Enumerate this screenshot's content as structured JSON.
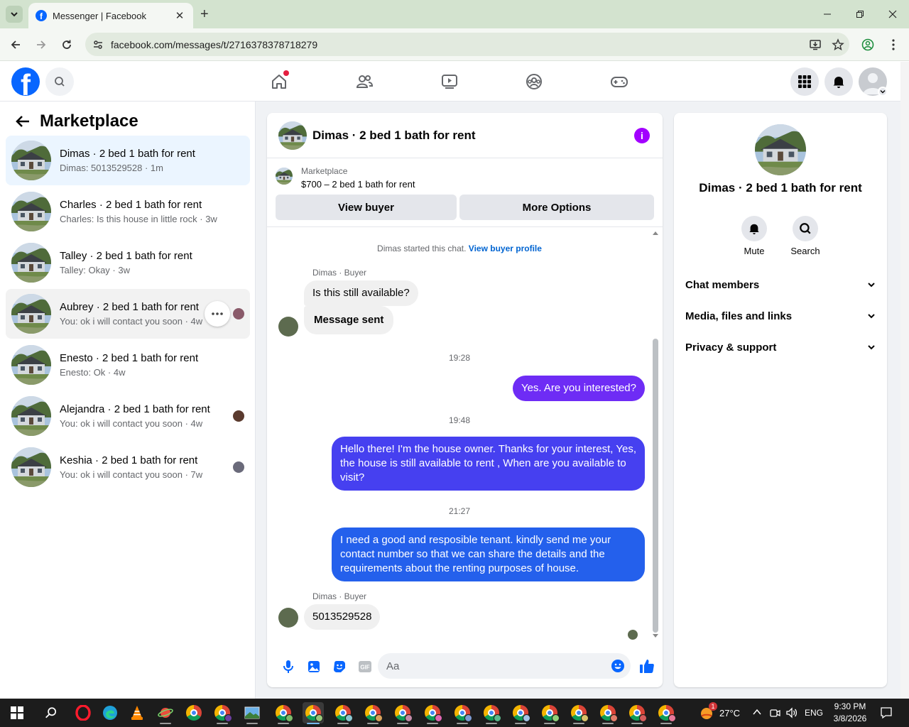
{
  "browser": {
    "tab_title": "Messenger | Facebook",
    "url": "facebook.com/messages/t/2716378378718279"
  },
  "left": {
    "title": "Marketplace",
    "chats": [
      {
        "name": "Dimas · 2 bed 1 bath for rent",
        "preview": "Dimas: 5013529528 · 1m",
        "state": "active"
      },
      {
        "name": "Charles · 2 bed 1 bath for rent",
        "preview": "Charles: Is this house in little rock · 3w",
        "state": ""
      },
      {
        "name": "Talley · 2 bed 1 bath for rent",
        "preview": "Talley: Okay · 3w",
        "state": ""
      },
      {
        "name": "Aubrey · 2 bed 1 bath for rent",
        "preview": "You: ok i will contact you soon · 4w",
        "state": "hover"
      },
      {
        "name": "Enesto · 2 bed 1 bath for rent",
        "preview": "Enesto: Ok · 4w",
        "state": ""
      },
      {
        "name": "Alejandra · 2 bed 1 bath for rent",
        "preview": "You: ok i will contact you soon · 4w",
        "state": ""
      },
      {
        "name": "Keshia · 2 bed 1 bath for rent",
        "preview": "You: ok i will contact you soon · 7w",
        "state": ""
      }
    ]
  },
  "conversation": {
    "title": "Dimas · 2 bed 1 bath for rent",
    "listing_category": "Marketplace",
    "listing_title": "$700 – 2 bed 1 bath for rent",
    "view_buyer_label": "View buyer",
    "more_options_label": "More Options",
    "system_text": "Dimas started this chat.",
    "system_link": "View buyer profile",
    "sender_label": "Dimas · Buyer",
    "msg_in_1": "Is this still available?",
    "msg_in_2": "Message sent",
    "time_1": "19:28",
    "msg_out_1": "Yes. Are you interested?",
    "time_2": "19:48",
    "msg_out_2": "Hello there! I'm the house owner. Thanks for your interest, Yes, the house is still available to rent , When are you available to visit?",
    "time_3": "21:27",
    "msg_out_3": "I need a good and resposible tenant.  kindly send me your contact number so that we can share the details and the requirements about the renting purposes of house.",
    "msg_in_3": "5013529528",
    "composer_placeholder": "Aa",
    "colors": {
      "out_1": "#6e2cf5",
      "out_2": "#4640f0",
      "out_3": "#2460ec",
      "accent": "#0866ff",
      "info": "#a200ff"
    }
  },
  "info_panel": {
    "name": "Dimas · 2 bed 1 bath for rent",
    "mute_label": "Mute",
    "search_label": "Search",
    "sections": [
      "Chat members",
      "Media, files and links",
      "Privacy & support"
    ]
  },
  "taskbar": {
    "weather": "27°C",
    "lang": "ENG",
    "time": "9:30 PM",
    "date": "3/8/2026",
    "notification_count": "1"
  }
}
